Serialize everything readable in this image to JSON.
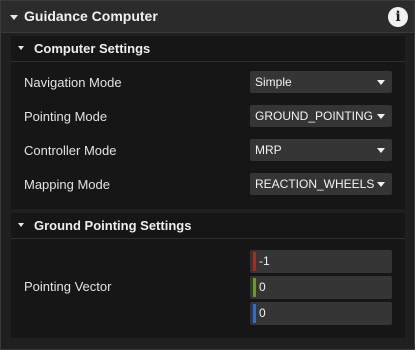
{
  "header": {
    "title": "Guidance Computer",
    "info_glyph": "i",
    "icons": {
      "collapse": "triangle-down-icon",
      "info": "info-icon"
    }
  },
  "computer_settings": {
    "title": "Computer Settings",
    "rows": [
      {
        "label": "Navigation Mode",
        "value": "Simple"
      },
      {
        "label": "Pointing Mode",
        "value": "GROUND_POINTING"
      },
      {
        "label": "Controller Mode",
        "value": "MRP"
      },
      {
        "label": "Mapping Mode",
        "value": "REACTION_WHEELS"
      }
    ]
  },
  "ground_pointing_settings": {
    "title": "Ground Pointing Settings",
    "pointing_vector": {
      "label": "Pointing Vector",
      "x": "-1",
      "y": "0",
      "z": "0"
    }
  },
  "colors": {
    "background": "#1f1f1f",
    "header": "#2b2b2b",
    "section": "#161616",
    "field": "#353535",
    "axis_x": "#b3261e",
    "axis_y": "#6a9a22",
    "axis_z": "#2e6fd1"
  }
}
